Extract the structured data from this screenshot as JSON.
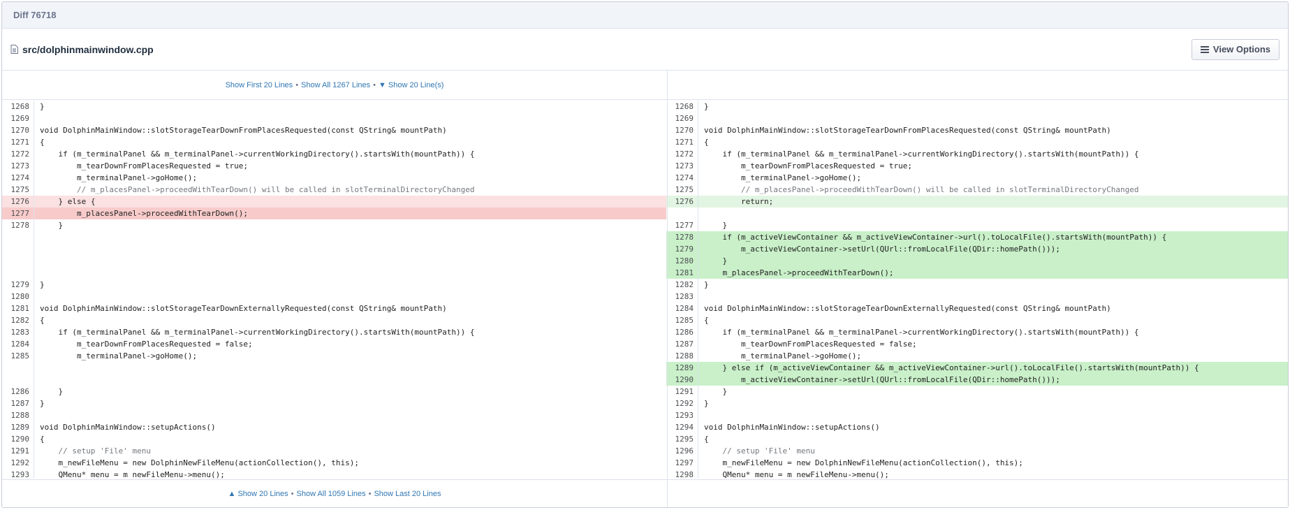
{
  "diff_title": "Diff 76718",
  "file": {
    "path": "src/dolphinmainwindow.cpp",
    "view_options_label": "View Options"
  },
  "context_top": {
    "show_first": "Show First 20 Lines",
    "show_all": "Show All 1267 Lines",
    "show_more": "▼ Show 20 Line(s)",
    "separator": "•"
  },
  "context_bottom": {
    "show_up": "▲ Show 20 Lines",
    "show_all": "Show All 1059 Lines",
    "show_last": "Show Last 20 Lines",
    "separator": "•"
  },
  "rows": [
    {
      "l": "1268",
      "lc": "}",
      "r": "1268",
      "rc": "}"
    },
    {
      "l": "1269",
      "lc": "",
      "r": "1269",
      "rc": ""
    },
    {
      "l": "1270",
      "lc": "void DolphinMainWindow::slotStorageTearDownFromPlacesRequested(const QString& mountPath)",
      "r": "1270",
      "rc": "void DolphinMainWindow::slotStorageTearDownFromPlacesRequested(const QString& mountPath)"
    },
    {
      "l": "1271",
      "lc": "{",
      "r": "1271",
      "rc": "{"
    },
    {
      "l": "1272",
      "lc": "    if (m_terminalPanel && m_terminalPanel->currentWorkingDirectory().startsWith(mountPath)) {",
      "r": "1272",
      "rc": "    if (m_terminalPanel && m_terminalPanel->currentWorkingDirectory().startsWith(mountPath)) {"
    },
    {
      "l": "1273",
      "lc": "        m_tearDownFromPlacesRequested = true;",
      "r": "1273",
      "rc": "        m_tearDownFromPlacesRequested = true;"
    },
    {
      "l": "1274",
      "lc": "        m_terminalPanel->goHome();",
      "r": "1274",
      "rc": "        m_terminalPanel->goHome();"
    },
    {
      "l": "1275",
      "lc": "        // m_placesPanel->proceedWithTearDown() will be called in slotTerminalDirectoryChanged",
      "r": "1275",
      "rc": "        // m_placesPanel->proceedWithTearDown() will be called in slotTerminalDirectoryChanged"
    },
    {
      "l": "1276",
      "lc": "    } else {",
      "r": "1276",
      "rc": "        return;",
      "ls": "old",
      "rs": "new"
    },
    {
      "l": "1277",
      "lc": "        m_placesPanel->proceedWithTearDown();",
      "r": "",
      "rc": "",
      "ls": "oldfull"
    },
    {
      "l": "1278",
      "lc": "    }",
      "r": "1277",
      "rc": "    }"
    },
    {
      "l": "",
      "lc": "",
      "r": "1278",
      "rc": "    if (m_activeViewContainer && m_activeViewContainer->url().toLocalFile().startsWith(mountPath)) {",
      "rs": "newfull"
    },
    {
      "l": "",
      "lc": "",
      "r": "1279",
      "rc": "        m_activeViewContainer->setUrl(QUrl::fromLocalFile(QDir::homePath()));",
      "rs": "newfull"
    },
    {
      "l": "",
      "lc": "",
      "r": "1280",
      "rc": "    }",
      "rs": "newfull"
    },
    {
      "l": "",
      "lc": "",
      "r": "1281",
      "rc": "    m_placesPanel->proceedWithTearDown();",
      "rs": "newfull"
    },
    {
      "l": "1279",
      "lc": "}",
      "r": "1282",
      "rc": "}"
    },
    {
      "l": "1280",
      "lc": "",
      "r": "1283",
      "rc": ""
    },
    {
      "l": "1281",
      "lc": "void DolphinMainWindow::slotStorageTearDownExternallyRequested(const QString& mountPath)",
      "r": "1284",
      "rc": "void DolphinMainWindow::slotStorageTearDownExternallyRequested(const QString& mountPath)"
    },
    {
      "l": "1282",
      "lc": "{",
      "r": "1285",
      "rc": "{"
    },
    {
      "l": "1283",
      "lc": "    if (m_terminalPanel && m_terminalPanel->currentWorkingDirectory().startsWith(mountPath)) {",
      "r": "1286",
      "rc": "    if (m_terminalPanel && m_terminalPanel->currentWorkingDirectory().startsWith(mountPath)) {"
    },
    {
      "l": "1284",
      "lc": "        m_tearDownFromPlacesRequested = false;",
      "r": "1287",
      "rc": "        m_tearDownFromPlacesRequested = false;"
    },
    {
      "l": "1285",
      "lc": "        m_terminalPanel->goHome();",
      "r": "1288",
      "rc": "        m_terminalPanel->goHome();"
    },
    {
      "l": "",
      "lc": "",
      "r": "1289",
      "rc": "    } else if (m_activeViewContainer && m_activeViewContainer->url().toLocalFile().startsWith(mountPath)) {",
      "rs": "newfull"
    },
    {
      "l": "",
      "lc": "",
      "r": "1290",
      "rc": "        m_activeViewContainer->setUrl(QUrl::fromLocalFile(QDir::homePath()));",
      "rs": "newfull"
    },
    {
      "l": "1286",
      "lc": "    }",
      "r": "1291",
      "rc": "    }"
    },
    {
      "l": "1287",
      "lc": "}",
      "r": "1292",
      "rc": "}"
    },
    {
      "l": "1288",
      "lc": "",
      "r": "1293",
      "rc": ""
    },
    {
      "l": "1289",
      "lc": "void DolphinMainWindow::setupActions()",
      "r": "1294",
      "rc": "void DolphinMainWindow::setupActions()"
    },
    {
      "l": "1290",
      "lc": "{",
      "r": "1295",
      "rc": "{"
    },
    {
      "l": "1291",
      "lc": "    // setup 'File' menu",
      "r": "1296",
      "rc": "    // setup 'File' menu"
    },
    {
      "l": "1292",
      "lc": "    m_newFileMenu = new DolphinNewFileMenu(actionCollection(), this);",
      "r": "1297",
      "rc": "    m_newFileMenu = new DolphinNewFileMenu(actionCollection(), this);"
    },
    {
      "l": "1293",
      "lc": "    QMenu* menu = m_newFileMenu->menu();",
      "r": "1298",
      "rc": "    QMenu* menu = m_newFileMenu->menu();"
    }
  ]
}
